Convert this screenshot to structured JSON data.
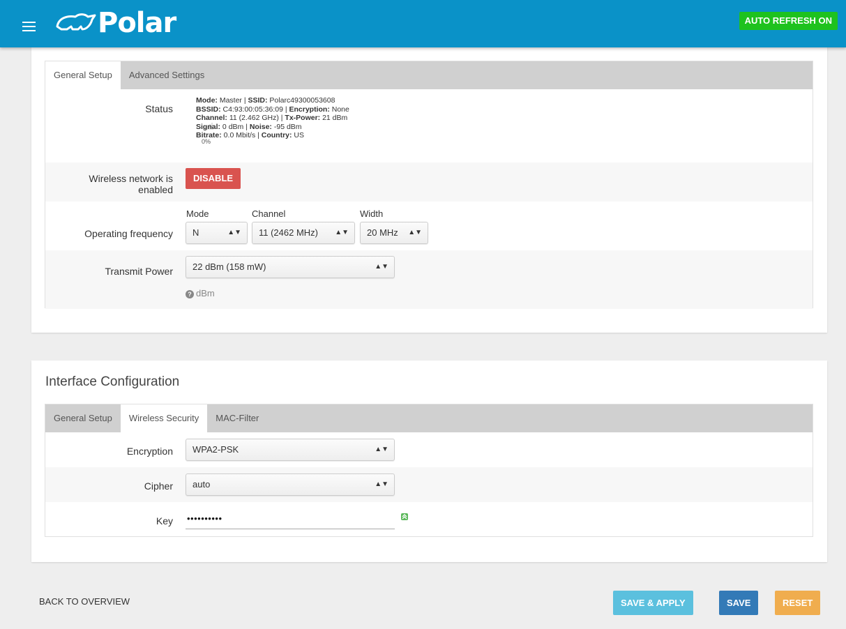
{
  "header": {
    "app_name": "Polar",
    "auto_refresh_label": "AUTO REFRESH ON",
    "colors": {
      "bar": "#0a92c8",
      "auto_refresh": "#1ec21e"
    }
  },
  "device": {
    "tabs": [
      "General Setup",
      "Advanced Settings"
    ],
    "active_tab": "General Setup",
    "status": {
      "label": "Status",
      "signal_percent": "0%",
      "mode_key": "Mode:",
      "mode_val": " Master | ",
      "ssid_key": "SSID:",
      "ssid_val": " Polarc49300053608",
      "bssid_key": "BSSID:",
      "bssid_val": " C4:93:00:05:36:09 | ",
      "enc_key": "Encryption:",
      "enc_val": " None",
      "channel_key": "Channel:",
      "channel_val": " 11 (2.462 GHz) | ",
      "txp_key": "Tx-Power:",
      "txp_val": " 21 dBm",
      "signal_key": "Signal:",
      "signal_val": " 0 dBm | ",
      "noise_key": "Noise:",
      "noise_val": " -95 dBm",
      "bitrate_key": "Bitrate:",
      "bitrate_val": " 0.0 Mbit/s | ",
      "country_key": "Country:",
      "country_val": " US"
    },
    "wireless": {
      "label_line1": "Wireless network is",
      "label_line2": "enabled",
      "disable_label": "DISABLE"
    },
    "frequency": {
      "label": "Operating frequency",
      "mode_label": "Mode",
      "mode_value": "N",
      "channel_label": "Channel",
      "channel_value": "11 (2462 MHz)",
      "width_label": "Width",
      "width_value": "20 MHz"
    },
    "power": {
      "label": "Transmit Power",
      "value": "22 dBm (158 mW)",
      "hint": "dBm"
    }
  },
  "interface": {
    "title": "Interface Configuration",
    "tabs": [
      "General Setup",
      "Wireless Security",
      "MAC-Filter"
    ],
    "active_tab": "Wireless Security",
    "encryption": {
      "label": "Encryption",
      "value": "WPA2-PSK"
    },
    "cipher": {
      "label": "Cipher",
      "value": "auto"
    },
    "key": {
      "label": "Key",
      "value": "••••••••••"
    }
  },
  "footer": {
    "back_label": "BACK TO OVERVIEW",
    "save_apply_label": "SAVE & APPLY",
    "save_label": "SAVE",
    "reset_label": "RESET"
  }
}
